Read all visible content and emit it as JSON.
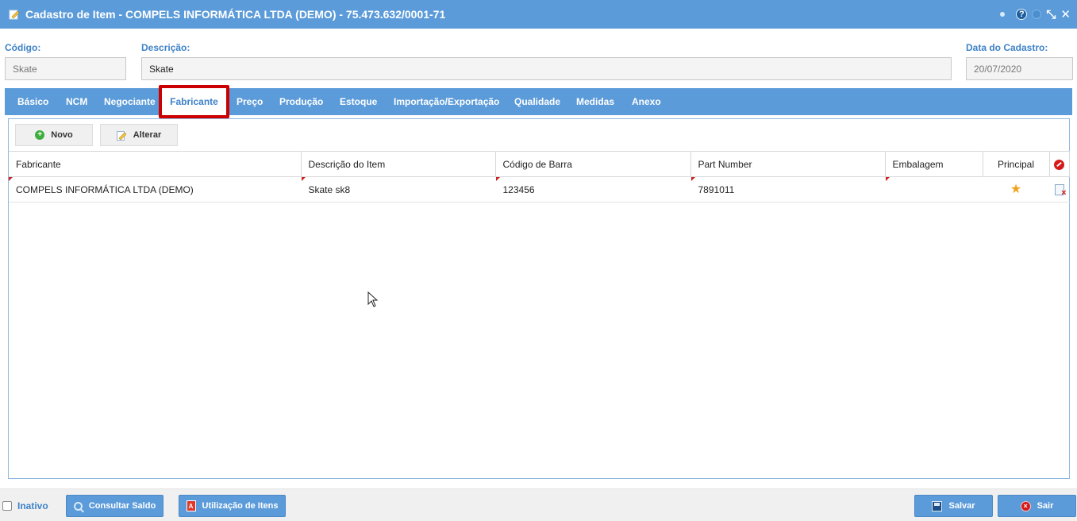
{
  "window": {
    "title": "Cadastro de Item - COMPELS INFORMÁTICA LTDA (DEMO) - 75.473.632/0001-71",
    "help_label": "?",
    "restore_glyph": "⤡",
    "close_glyph": "✕"
  },
  "header": {
    "codigo_label": "Código:",
    "codigo_value": "Skate",
    "descricao_label": "Descrição:",
    "descricao_value": "Skate",
    "data_label": "Data do Cadastro:",
    "data_value": "20/07/2020"
  },
  "tabs": [
    {
      "label": "Básico"
    },
    {
      "label": "NCM"
    },
    {
      "label": "Negociante"
    },
    {
      "label": "Fabricante",
      "active": true
    },
    {
      "label": "Preço"
    },
    {
      "label": "Produção"
    },
    {
      "label": "Estoque"
    },
    {
      "label": "Importação/Exportação"
    },
    {
      "label": "Qualidade"
    },
    {
      "label": "Medidas"
    },
    {
      "label": "Anexo"
    }
  ],
  "toolbar": {
    "novo_label": "Novo",
    "alterar_label": "Alterar",
    "plus_glyph": "+"
  },
  "table": {
    "columns": [
      "Fabricante",
      "Descrição do Item",
      "Código de Barra",
      "Part Number",
      "Embalagem",
      "Principal"
    ],
    "rows": [
      {
        "fabricante": "COMPELS INFORMÁTICA LTDA (DEMO)",
        "descricao": "Skate sk8",
        "codigo_barra": "123456",
        "part_number": "7891011",
        "embalagem": "",
        "principal_icon": "★"
      }
    ]
  },
  "footer": {
    "inativo_label": "Inativo",
    "consultar_label": "Consultar Saldo",
    "utilizacao_label": "Utilização de Itens",
    "salvar_label": "Salvar",
    "sair_label": "Sair",
    "pdf_glyph": "A",
    "exit_glyph": "×"
  },
  "colors": {
    "accent": "#5b9bd9",
    "label_blue": "#3e82c8",
    "highlight_red": "#cc0000"
  }
}
